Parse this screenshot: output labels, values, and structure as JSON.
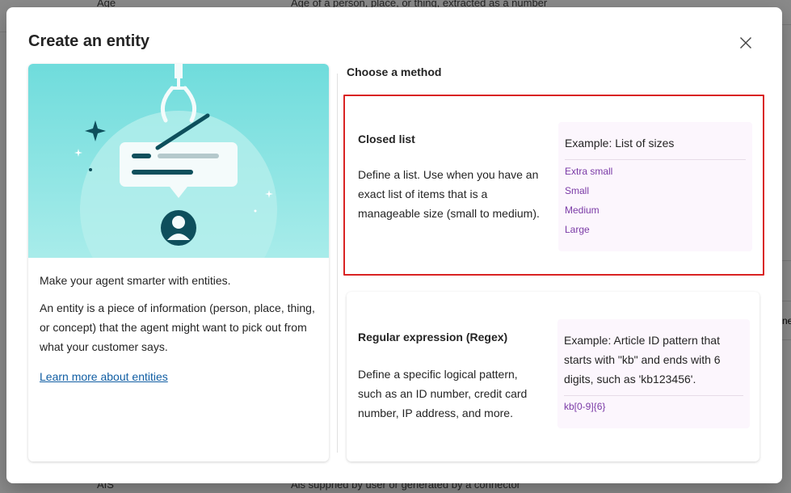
{
  "background": {
    "top_row": {
      "name": "Age",
      "description": "Age of a person, place, or thing, extracted as a number"
    },
    "bottom_row": {
      "name": "AIS",
      "description": "Ais suppried by user or generated by a connector"
    },
    "edge_text": "ne"
  },
  "modal": {
    "title": "Create an entity",
    "close_label": "Close"
  },
  "left_panel": {
    "intro": "Make your agent smarter with entities.",
    "body": "An entity is a piece of information (person, place, thing, or concept) that the agent might want to pick out from what your customer says.",
    "link": "Learn more about entities"
  },
  "right_panel": {
    "heading": "Choose a method",
    "methods": [
      {
        "title": "Closed list",
        "description": "Define a list. Use when you have an exact list of items that is a manageable size (small to medium).",
        "example_title": "Example: List of sizes",
        "example_items": [
          "Extra small",
          "Small",
          "Medium",
          "Large"
        ],
        "selected": true
      },
      {
        "title": "Regular expression (Regex)",
        "description": "Define a specific logical pattern, such as an ID number, credit card number, IP address, and more.",
        "example_title": "Example: Article ID pattern that starts with \"kb\" and ends with 6 digits, such as 'kb123456'.",
        "example_code": "kb[0-9]{6}",
        "selected": false
      }
    ]
  },
  "colors": {
    "selection_border": "#d92323",
    "example_text": "#7a3aa6",
    "link": "#115ea3",
    "hero_bg": "#6fdcdc"
  }
}
